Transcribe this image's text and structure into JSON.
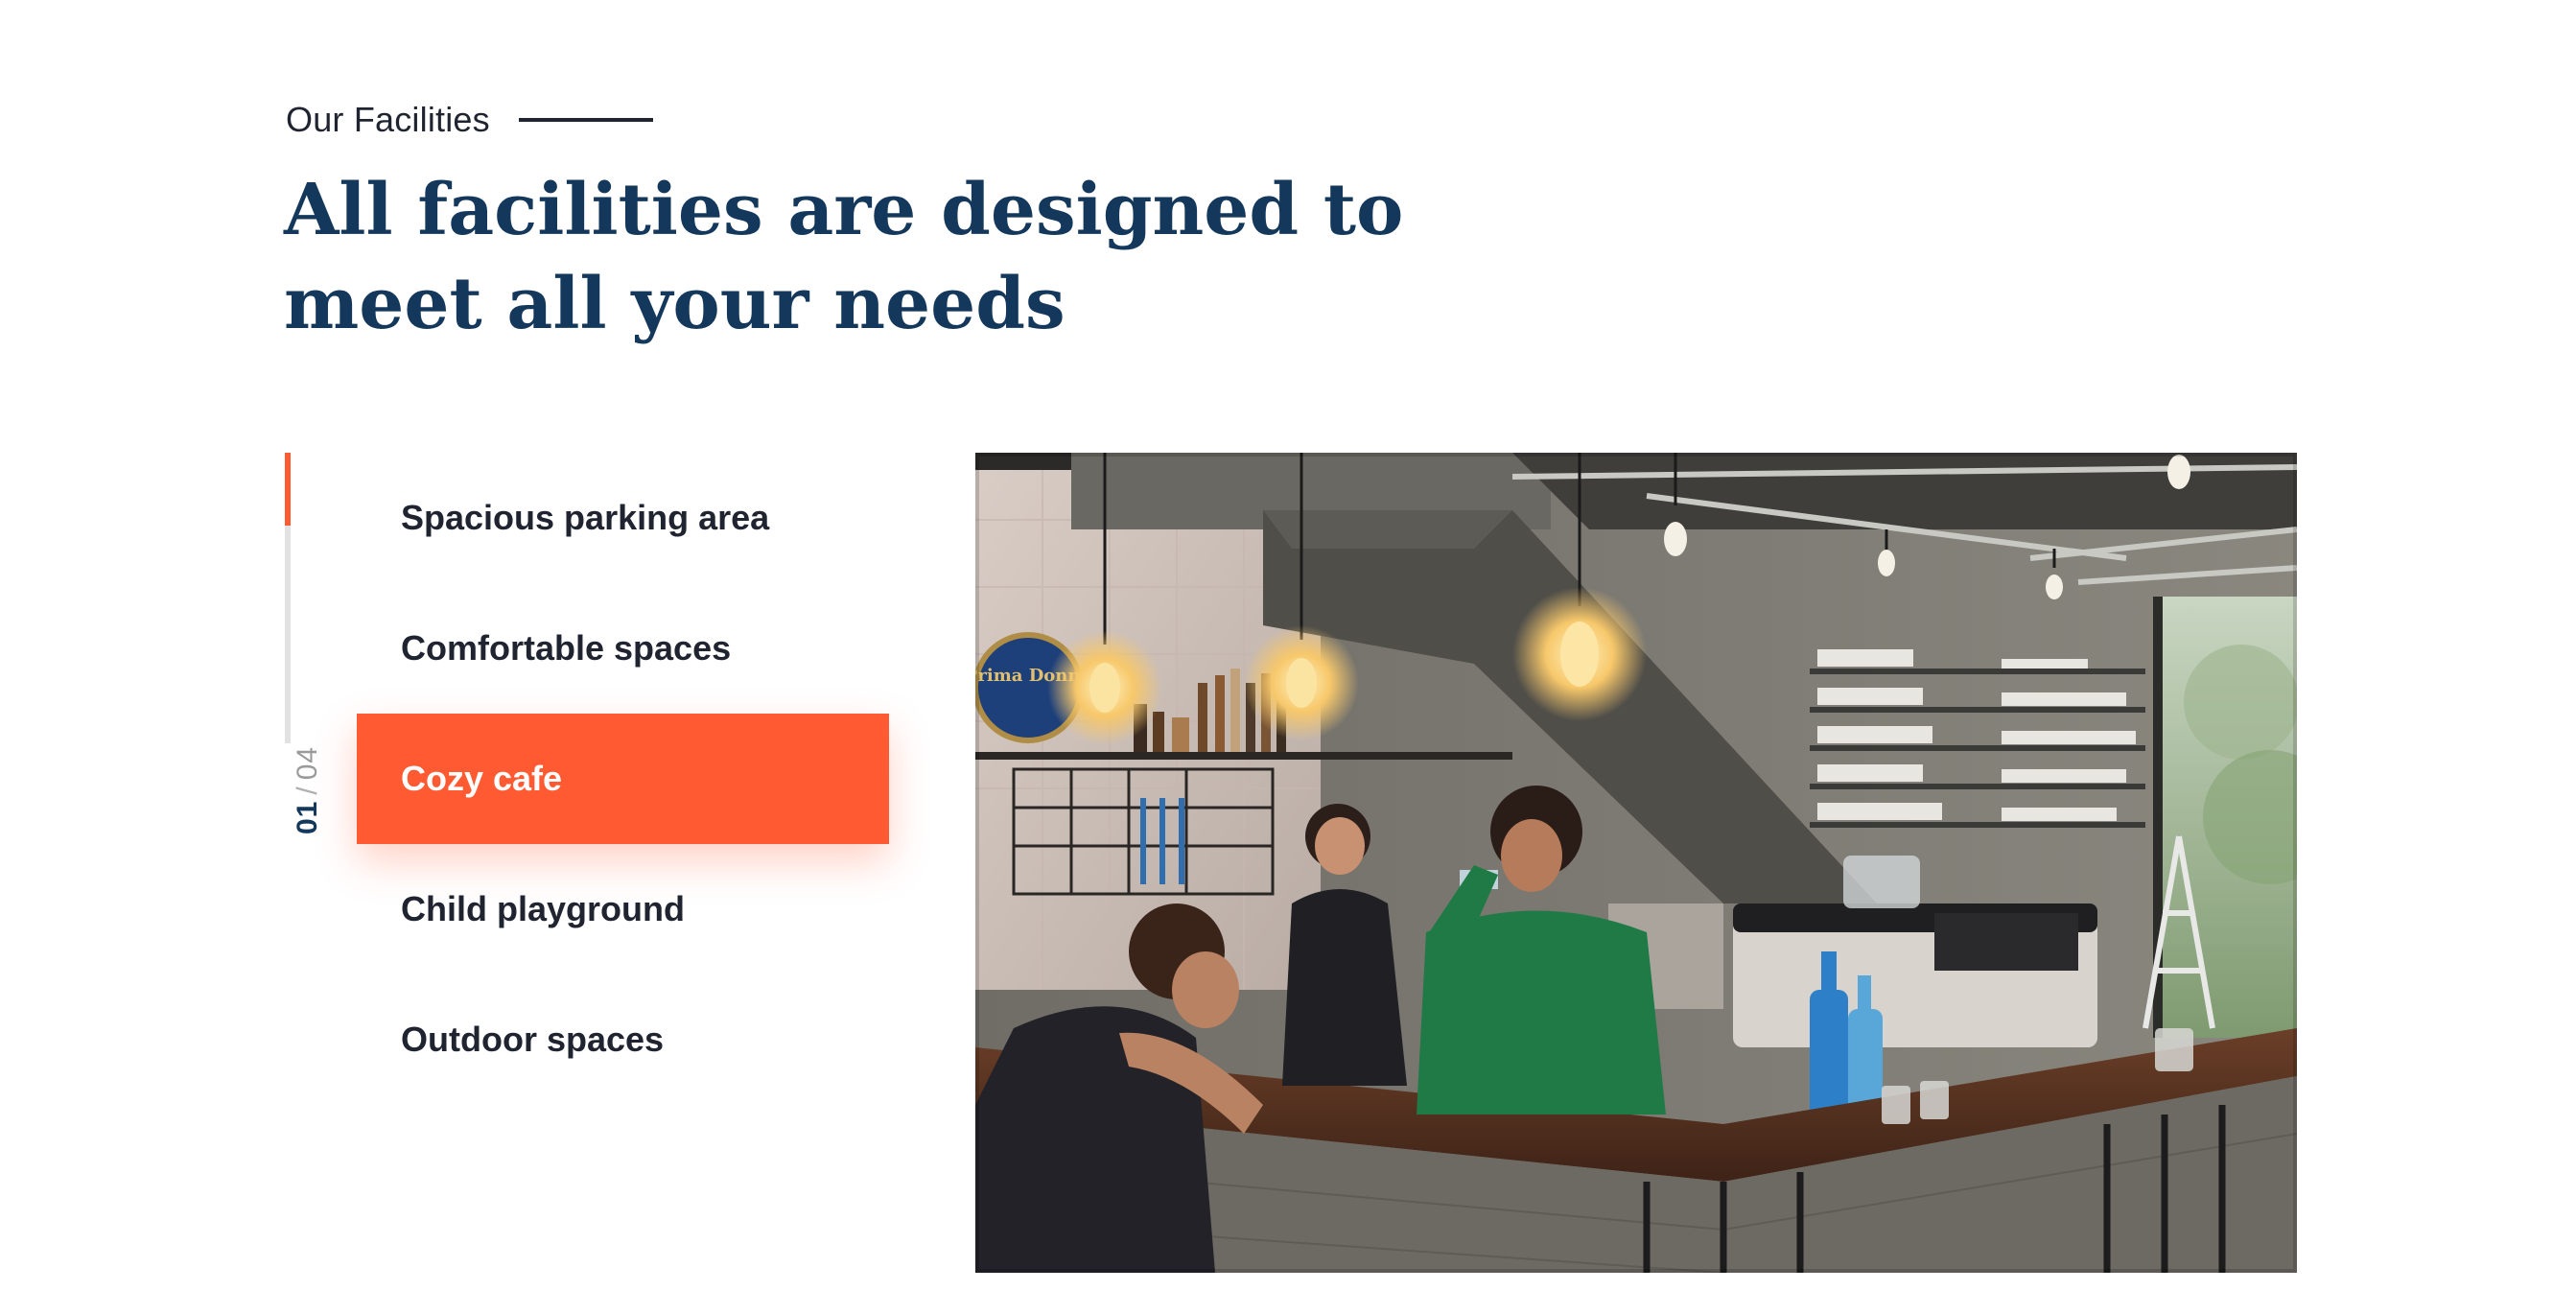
{
  "section": {
    "eyebrow": "Our Facilities",
    "headline": "All facilities are designed to meet all your needs"
  },
  "facilities": {
    "current_index": "01",
    "separator": "/",
    "total": "04",
    "progress_fraction": 0.25,
    "items": [
      {
        "label": "Spacious parking area",
        "active": false
      },
      {
        "label": "Comfortable spaces",
        "active": false
      },
      {
        "label": "Cozy cafe",
        "active": true
      },
      {
        "label": "Child playground",
        "active": false
      },
      {
        "label": "Outdoor spaces",
        "active": false
      }
    ]
  },
  "photo": {
    "subject": "cafe-interior-photo",
    "sign_text": "Prima Donna"
  },
  "colors": {
    "accent": "#ff5a32",
    "heading": "#14385c",
    "text": "#1f2430",
    "track": "#e2e2e2"
  }
}
